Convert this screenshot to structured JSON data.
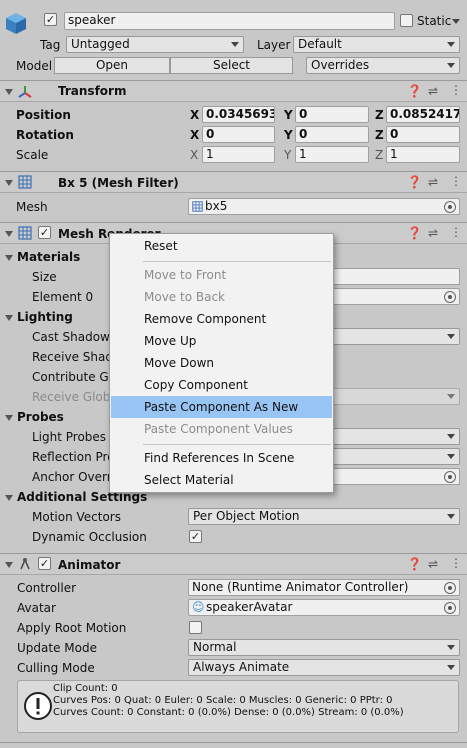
{
  "object": {
    "name": "speaker",
    "static_label": "Static",
    "tag_label": "Tag",
    "tag_value": "Untagged",
    "layer_label": "Layer",
    "layer_value": "Default",
    "model_label": "Model",
    "open_label": "Open",
    "select_label": "Select",
    "overrides_label": "Overrides"
  },
  "transform": {
    "title": "Transform",
    "position_label": "Position",
    "rotation_label": "Rotation",
    "scale_label": "Scale",
    "axis_x": "X",
    "axis_y": "Y",
    "axis_z": "Z",
    "position": {
      "x": "0.0345693",
      "y": "0",
      "z": "0.0852417"
    },
    "rotation": {
      "x": "0",
      "y": "0",
      "z": "0"
    },
    "scale": {
      "x": "1",
      "y": "1",
      "z": "1"
    }
  },
  "mesh_filter": {
    "title": "Bx 5 (Mesh Filter)",
    "mesh_label": "Mesh",
    "mesh_value": "bx5"
  },
  "mesh_renderer": {
    "title": "Mesh Renderer",
    "materials": "Materials",
    "size": "Size",
    "element0": "Element 0",
    "lighting": "Lighting",
    "cast_shadows": "Cast Shadow",
    "receive_shadows": "Receive Shad",
    "contribute_gi": "Contribute Glo",
    "receive_gi": "Receive Glob",
    "probes": "Probes",
    "light_probes": "Light Probes",
    "reflection_probes": "Reflection Pro",
    "anchor_override": "Anchor Overri",
    "additional": "Additional Settings",
    "motion_vectors": "Motion Vectors",
    "motion_vectors_value": "Per Object Motion",
    "dynamic_occlusion": "Dynamic Occlusion"
  },
  "context_menu": {
    "items": [
      {
        "label": "Reset",
        "disabled": false
      },
      {
        "label": "Move to Front",
        "disabled": true
      },
      {
        "label": "Move to Back",
        "disabled": true
      },
      {
        "label": "Remove Component",
        "disabled": false
      },
      {
        "label": "Move Up",
        "disabled": false
      },
      {
        "label": "Move Down",
        "disabled": false
      },
      {
        "label": "Copy Component",
        "disabled": false
      },
      {
        "label": "Paste Component As New",
        "disabled": false,
        "highlighted": true
      },
      {
        "label": "Paste Component Values",
        "disabled": true
      },
      {
        "label": "Find References In Scene",
        "disabled": false
      },
      {
        "label": "Select Material",
        "disabled": false
      }
    ]
  },
  "animator": {
    "title": "Animator",
    "controller_label": "Controller",
    "controller_value": "None (Runtime Animator Controller)",
    "avatar_label": "Avatar",
    "avatar_value": "speakerAvatar",
    "apply_root_label": "Apply Root Motion",
    "update_mode_label": "Update Mode",
    "update_mode_value": "Normal",
    "culling_label": "Culling Mode",
    "culling_value": "Always Animate",
    "info_line1": "Clip Count: 0",
    "info_line2": "Curves Pos: 0 Quat: 0 Euler: 0 Scale: 0 Muscles: 0 Generic: 0 PPtr: 0",
    "info_line3": "Curves Count: 0 Constant: 0 (0.0%) Dense: 0 (0.0%) Stream: 0 (0.0%)"
  },
  "colors": {
    "background": "#c8c8c8",
    "highlight": "#98c5f3",
    "header": "#cbcbcb"
  }
}
